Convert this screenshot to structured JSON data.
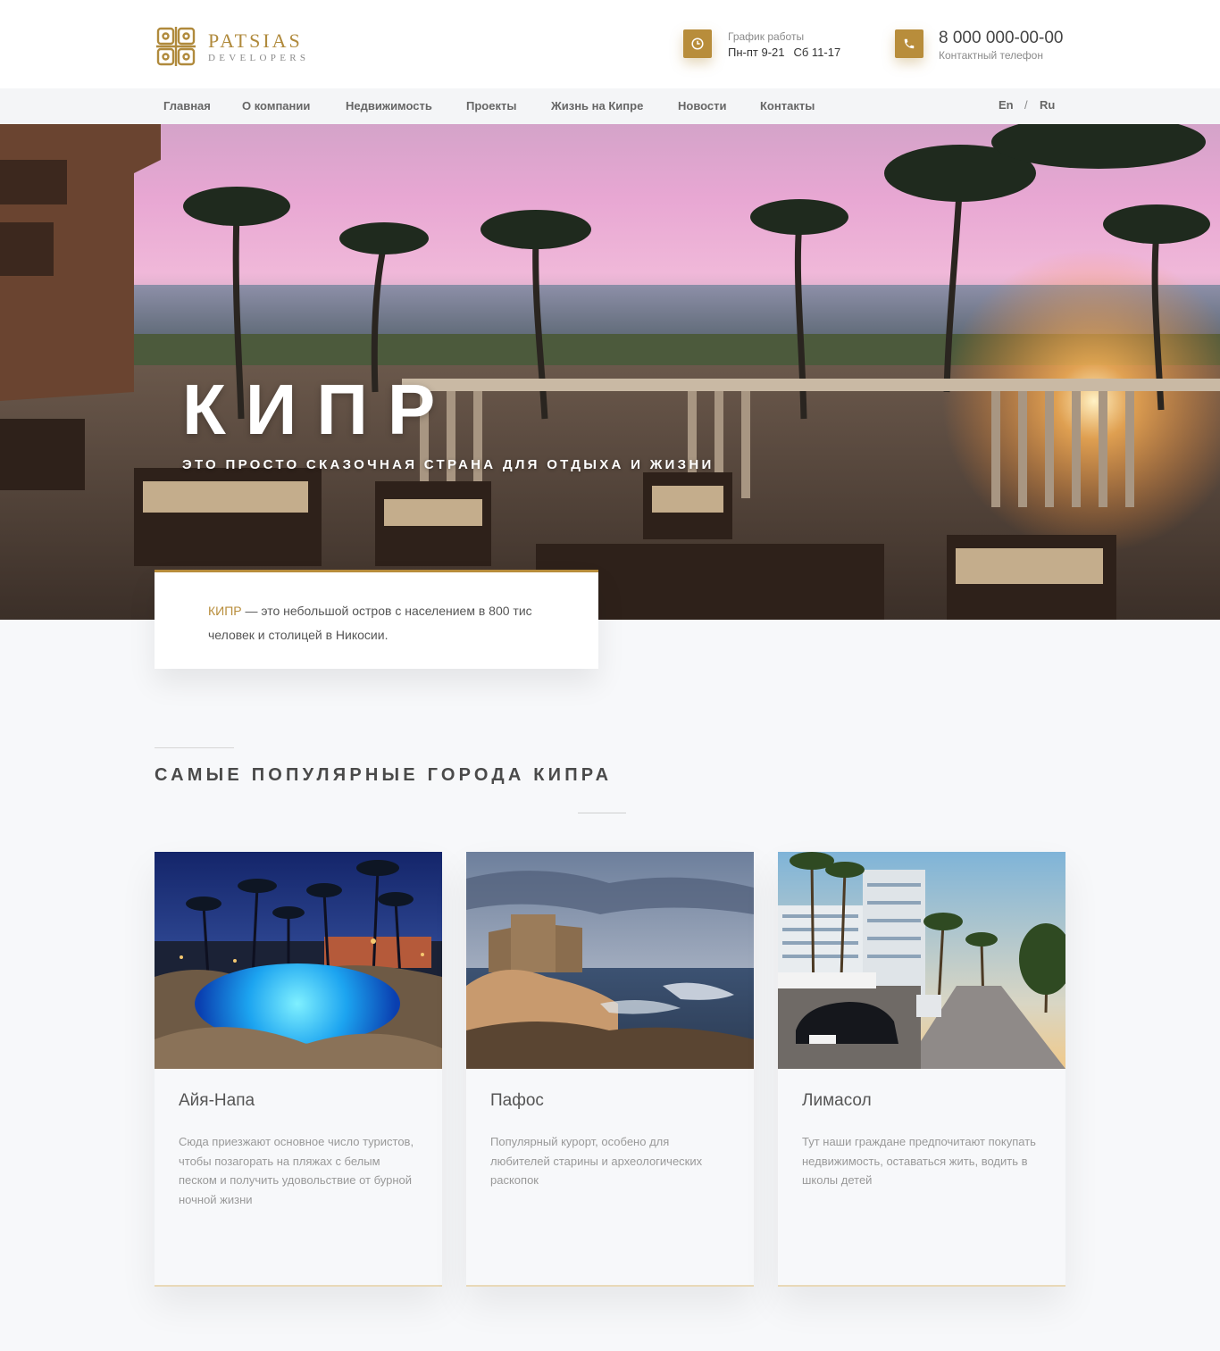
{
  "header": {
    "logo_name": "PATSIAS",
    "logo_sub": "DEVELOPERS",
    "schedule_label": "График работы",
    "schedule_weekdays": "Пн-пт 9-21",
    "schedule_saturday": "Сб 11-17",
    "phone_number": "8 000 000-00-00",
    "phone_label": "Контактный телефон",
    "schedule_icon": "clock-icon",
    "phone_icon": "phone-icon",
    "accent_color": "#b88d3b"
  },
  "nav": {
    "items": [
      "Главная",
      "О компании",
      "Недвижимость",
      "Проекты",
      "Жизнь на Кипре",
      "Новости",
      "Контакты"
    ],
    "lang_en": "En",
    "lang_sep": "/",
    "lang_ru": "Ru"
  },
  "hero": {
    "title": "КИПР",
    "subtitle": "ЭТО ПРОСТО СКАЗОЧНАЯ СТРАНА ДЛЯ ОТДЫХА И ЖИЗНИ",
    "intro_accent": "КИПР",
    "intro_text": " — это небольшой остров с населением в 800 тис человек и столицей в Никосии."
  },
  "section": {
    "title": "САМЫЕ ПОПУЛЯРНЫЕ ГОРОДА КИПРА"
  },
  "cities": [
    {
      "name": "Айя-Напа",
      "text": "Сюда приезжают основное число туристов, чтобы позагорать на пляжах с белым песком и получить удовольствие от бурной ночной жизни"
    },
    {
      "name": "Пафос",
      "text": "Популярный курорт, особено для любителей старины и археологических раскопок"
    },
    {
      "name": "Лимасол",
      "text": "Тут наши граждане предпочитают покупать недвижимость, оставаться жить, водить в школы детей"
    }
  ]
}
